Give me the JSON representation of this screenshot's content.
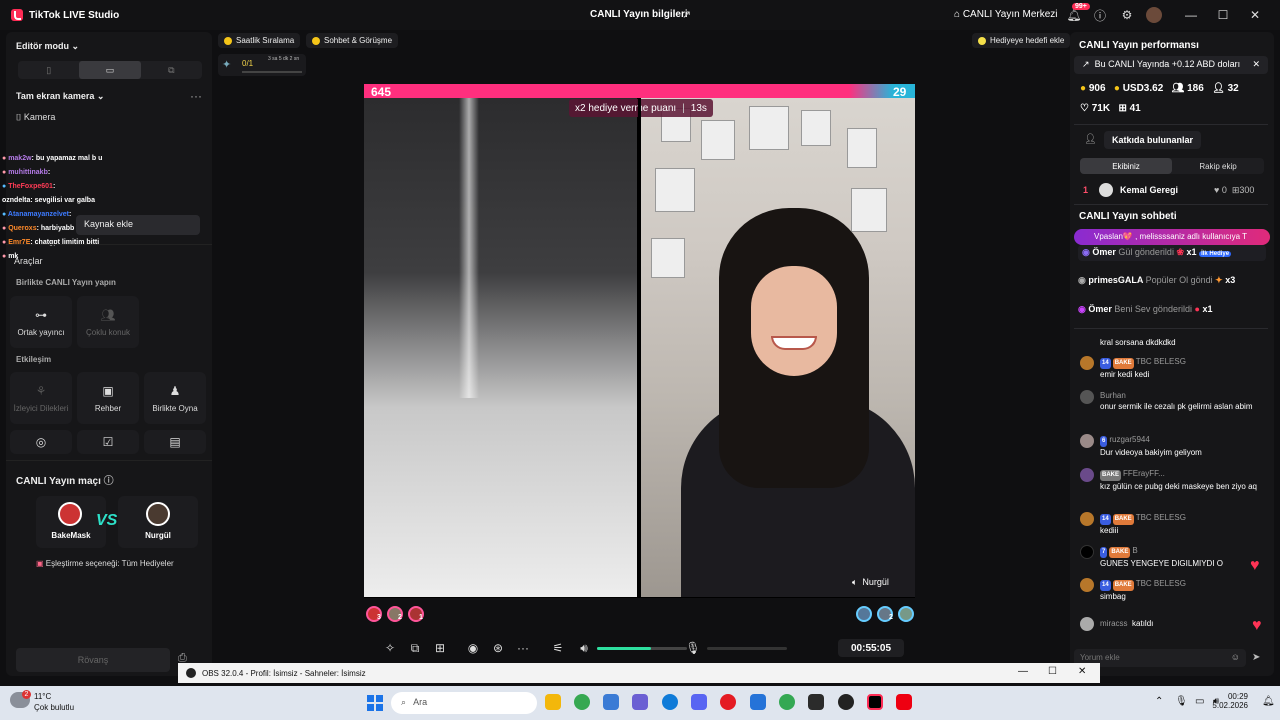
{
  "titlebar": {
    "app_name": "TikTok LIVE Studio",
    "center_title": "CANLI Yayın bilgileri",
    "hub_label": "CANLI Yayın Merkezi",
    "notif_count": "99+"
  },
  "left": {
    "mode_label": "Editör modu",
    "scene_label": "Tam ekran kamera",
    "camera_label": "Kamera",
    "add_source": "Kaynak ekle",
    "tools": "Araçlar",
    "chat_overlay": [
      {
        "user": "mak2w",
        "text": ": bu yapamaz mal b u",
        "color": "#b57be8"
      },
      {
        "user": "muhittinakb",
        "text": ":",
        "color": "#b57be8"
      },
      {
        "user": "TheFoxpe601",
        "text": ":",
        "color": "#ff3b55"
      },
      {
        "user": "ozndelta",
        "text": ": sevgilisi var galba",
        "color": "#ffffff"
      },
      {
        "user": "Atanamayanzelvet",
        "text": ":",
        "color": "#3d7bff"
      },
      {
        "user": "Queroxs",
        "text": ": harbiyabb",
        "color": "#ff8a2a"
      },
      {
        "user": "Emr7E",
        "text": ": chatgpt limitim bitti",
        "color": "#ff8a2a"
      },
      {
        "user": "",
        "text": "mk",
        "color": "#ffffff"
      }
    ],
    "together_title": "Birlikte CANLI Yayın yapın",
    "co_host": "Ortak yayıncı",
    "multi_guest": "Çoklu konuk",
    "interaction_title": "Etkileşim",
    "viewer_wishes": "İzleyici Dilekleri",
    "guide": "Rehber",
    "play_together": "Birlikte Oyna",
    "match_title": "CANLI Yayın maçı",
    "player1": "BakeMask",
    "player2": "Nurgül",
    "vs": "VS",
    "match_option": "Eşleştirme seçeneği: Tüm Hediyeler",
    "rematch": "Rövanş"
  },
  "top": {
    "hourly": "Saatlik Sıralama",
    "chat_meet": "Sohbet & Görüşme",
    "gift_goal": "Hediyeye hedefi ekle",
    "goal_progress": "0/1",
    "goal_time": "3 sa 5 dk 2 sn"
  },
  "battle": {
    "left_score": "645",
    "right_score": "29",
    "multiplier_text": "x2 hediye verme puanı",
    "multiplier_time": "13s",
    "opponent_name": "Nurgül",
    "left_ranks": [
      "3",
      "2",
      "1"
    ],
    "right_ranks": [
      "2"
    ]
  },
  "controls": {
    "timer": "00:55:05",
    "volume_level": 0.6
  },
  "right": {
    "perf_title": "CANLI Yayın performansı",
    "earnings_note": "Bu CANLI Yayında +0.12 ABD doları",
    "coins": "906",
    "usd": "USD3.62",
    "viewers": "186",
    "new": "32",
    "likes": "71K",
    "gifts": "41",
    "contributors": "Katkıda bulunanlar",
    "tab_your_team": "Ekibiniz",
    "tab_rival": "Rakip ekip",
    "top_rank": "1",
    "top_user": "Kemal Geregi",
    "top_val1": "0",
    "top_val2": "300",
    "chat_title": "CANLI Yayın sohbeti",
    "pinned": "Vpaslan💖 , melissssaniz adlı kullanıcıya T",
    "gift_rows": [
      {
        "user": "Ömer",
        "text": "Gül gönderildi",
        "count": "x1",
        "tag": "İlk Hediye"
      },
      {
        "user": "primesGALA",
        "text": "Popüler Ol göndi",
        "count": "x3",
        "tag": ""
      },
      {
        "user": "Ömer",
        "text": "Beni Sev gönderildi",
        "count": "x1",
        "tag": ""
      }
    ],
    "messages": [
      {
        "lvl": "",
        "fan": "",
        "name": "",
        "text": "kral sorsana dkdkdkd"
      },
      {
        "lvl": "14",
        "fan": "BAKE",
        "name": "TBC BELESG",
        "text": "emir kedi kedi"
      },
      {
        "lvl": "",
        "fan": "",
        "name": "Burhan",
        "text": "onur sermik ile cezalı pk gelirmi aslan abim"
      },
      {
        "lvl": "6",
        "fan": "",
        "name": "ruzgar5944",
        "text": "Dur videoya bakiyim geliyom"
      },
      {
        "lvl": "",
        "fan": "BAKE",
        "name": "FFErayFF...",
        "text": "kız gülün ce pubg deki maskeye ben ziyo aq"
      },
      {
        "lvl": "14",
        "fan": "BAKE",
        "name": "TBC BELESG",
        "text": "kediii"
      },
      {
        "lvl": "7",
        "fan": "BAKE",
        "name": "B",
        "text": "GUNES YENGEYE DIGILMIYDI O"
      },
      {
        "lvl": "14",
        "fan": "BAKE",
        "name": "TBC BELESG",
        "text": "simbag"
      }
    ],
    "joined_user": "miracss",
    "joined_text": "katıldı",
    "comment_placeholder": "Yorum ekle"
  },
  "obs": {
    "title": "OBS 32.0.4 - Profil: İsimsiz - Sahneler: İsimsiz"
  },
  "taskbar": {
    "temp": "11°C",
    "weather": "Çok bulutlu",
    "search": "Ara",
    "time": "00:29",
    "date": "5.02.2026",
    "weather_badge": "2"
  }
}
